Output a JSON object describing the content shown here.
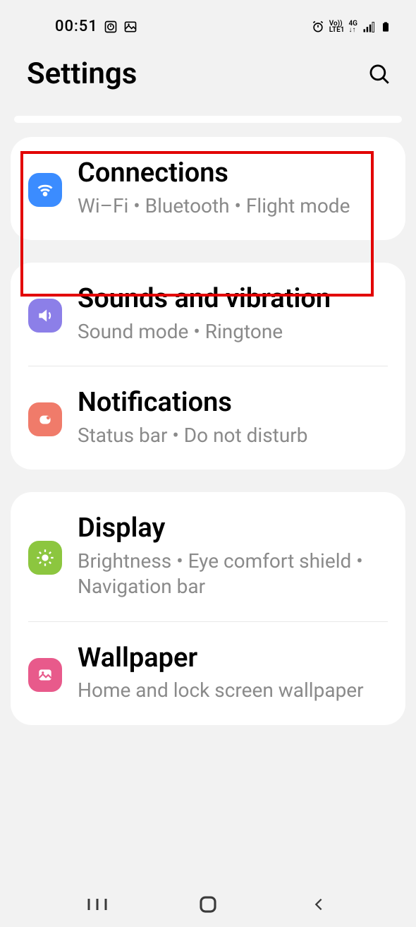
{
  "status": {
    "time": "00:51",
    "volte_top": "Vo))",
    "volte_bot": "LTE1",
    "net": "4G"
  },
  "header": {
    "title": "Settings"
  },
  "groups": [
    {
      "items": [
        {
          "title": "Connections",
          "subtitle": "Wi–Fi  •  Bluetooth  •  Flight mode"
        }
      ]
    },
    {
      "items": [
        {
          "title": "Sounds and vibration",
          "subtitle": "Sound mode  •  Ringtone"
        },
        {
          "title": "Notifications",
          "subtitle": "Status bar  •  Do not disturb"
        }
      ]
    },
    {
      "items": [
        {
          "title": "Display",
          "subtitle": "Brightness  •  Eye comfort shield  •  Navigation bar"
        },
        {
          "title": "Wallpaper",
          "subtitle": "Home and lock screen wallpaper"
        }
      ]
    }
  ]
}
